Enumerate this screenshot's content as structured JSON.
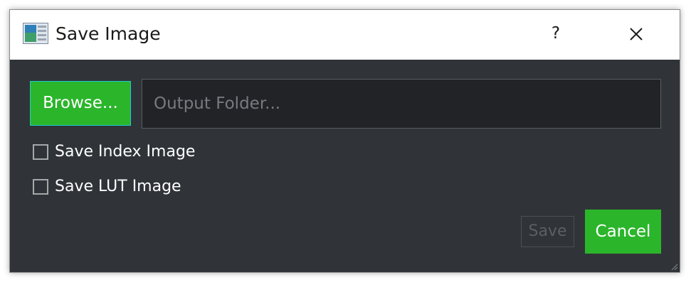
{
  "window": {
    "title": "Save Image",
    "help_label": "?",
    "icons": {
      "app": "app-image-icon",
      "close": "close-icon"
    }
  },
  "browse_button": {
    "label": "Browse..."
  },
  "output_folder": {
    "value": "",
    "placeholder": "Output Folder..."
  },
  "options": {
    "save_index_image": {
      "label": "Save Index Image",
      "checked": false
    },
    "save_lut_image": {
      "label": "Save LUT Image",
      "checked": false
    }
  },
  "actions": {
    "save_label": "Save",
    "save_enabled": false,
    "cancel_label": "Cancel"
  },
  "colors": {
    "accent_green": "#2bb52b",
    "dialog_background": "#303438",
    "input_background": "#212326",
    "titlebar_background": "#ffffff"
  }
}
